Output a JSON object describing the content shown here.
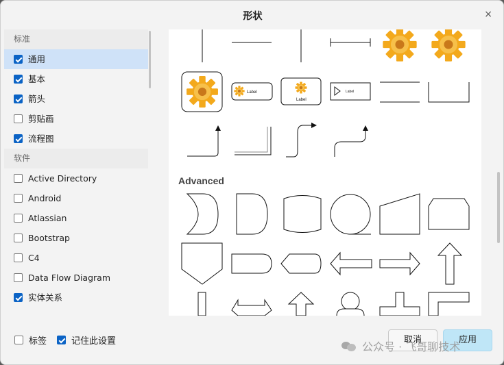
{
  "dialog": {
    "title": "形状",
    "close_symbol": "×"
  },
  "sidebar": {
    "groups": [
      {
        "title": "标准",
        "items": [
          {
            "label": "通用",
            "checked": true,
            "selected": true
          },
          {
            "label": "基本",
            "checked": true
          },
          {
            "label": "箭头",
            "checked": true
          },
          {
            "label": "剪贴画",
            "checked": false
          },
          {
            "label": "流程图",
            "checked": true
          }
        ]
      },
      {
        "title": "软件",
        "items": [
          {
            "label": "Active Directory",
            "checked": false
          },
          {
            "label": "Android",
            "checked": false
          },
          {
            "label": "Atlassian",
            "checked": false
          },
          {
            "label": "Bootstrap",
            "checked": false
          },
          {
            "label": "C4",
            "checked": false
          },
          {
            "label": "Data Flow Diagram",
            "checked": false
          },
          {
            "label": "实体关系",
            "checked": true
          }
        ]
      }
    ]
  },
  "preview": {
    "section_advanced": "Advanced",
    "shape_label": "Label"
  },
  "footer": {
    "tags_label": "标签",
    "tags_checked": false,
    "remember_label": "记住此设置",
    "remember_checked": true,
    "cancel_label": "取消",
    "apply_label": "应用"
  },
  "watermark": {
    "text": "公众号 · 飞哥聊技术"
  },
  "colors": {
    "accent": "#0b63c5",
    "gear": "#f3a91c",
    "apply_bg": "#bfe6f7"
  }
}
